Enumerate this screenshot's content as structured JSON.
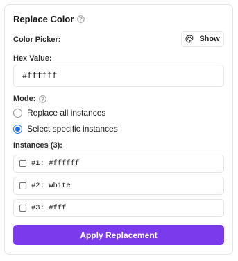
{
  "panel": {
    "title": "Replace Color",
    "title_help_icon": "help-circle-icon"
  },
  "color_picker": {
    "label": "Color Picker:",
    "button_label": "Show",
    "button_icon": "palette-icon"
  },
  "hex": {
    "label": "Hex Value:",
    "value": "#ffffff"
  },
  "mode": {
    "label": "Mode:",
    "help_icon": "help-circle-icon",
    "options": [
      {
        "label": "Replace all instances",
        "selected": false
      },
      {
        "label": "Select specific instances",
        "selected": true
      }
    ]
  },
  "instances": {
    "label": "Instances (3):",
    "items": [
      {
        "text": "#1: #ffffff",
        "checked": false
      },
      {
        "text": "#2: white",
        "checked": false
      },
      {
        "text": "#3: #fff",
        "checked": false
      }
    ]
  },
  "apply_button": {
    "label": "Apply Replacement"
  },
  "colors": {
    "accent": "#7c3aed",
    "radio_selected": "#1f6feb",
    "border": "#e4e4e7"
  }
}
